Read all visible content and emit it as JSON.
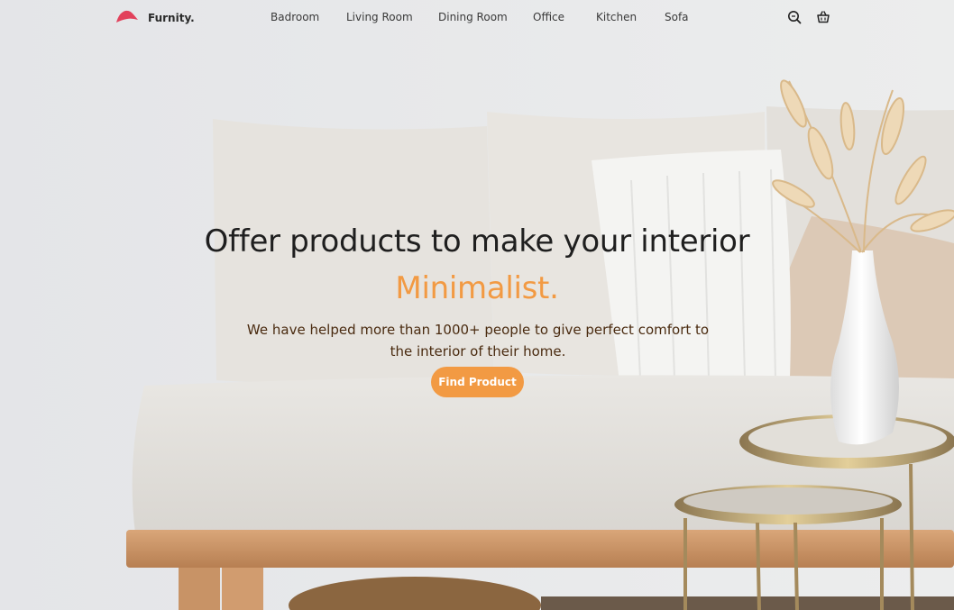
{
  "brand": {
    "name": "Furnity.",
    "accent_color": "#e2415b"
  },
  "nav": {
    "items": [
      {
        "label": "Badroom"
      },
      {
        "label": "Living Room"
      },
      {
        "label": "Dining Room"
      },
      {
        "label": "Office"
      },
      {
        "label": "Kitchen"
      },
      {
        "label": "Sofa"
      }
    ],
    "icons": [
      "search-icon",
      "basket-icon"
    ]
  },
  "hero": {
    "title": "Offer products to make your interior",
    "accent": "Minimalist.",
    "subtitle": "We have helped more than 1000+ people to give perfect comfort to the interior of their home.",
    "cta_label": "Find Product",
    "accent_color": "#f29a43"
  }
}
